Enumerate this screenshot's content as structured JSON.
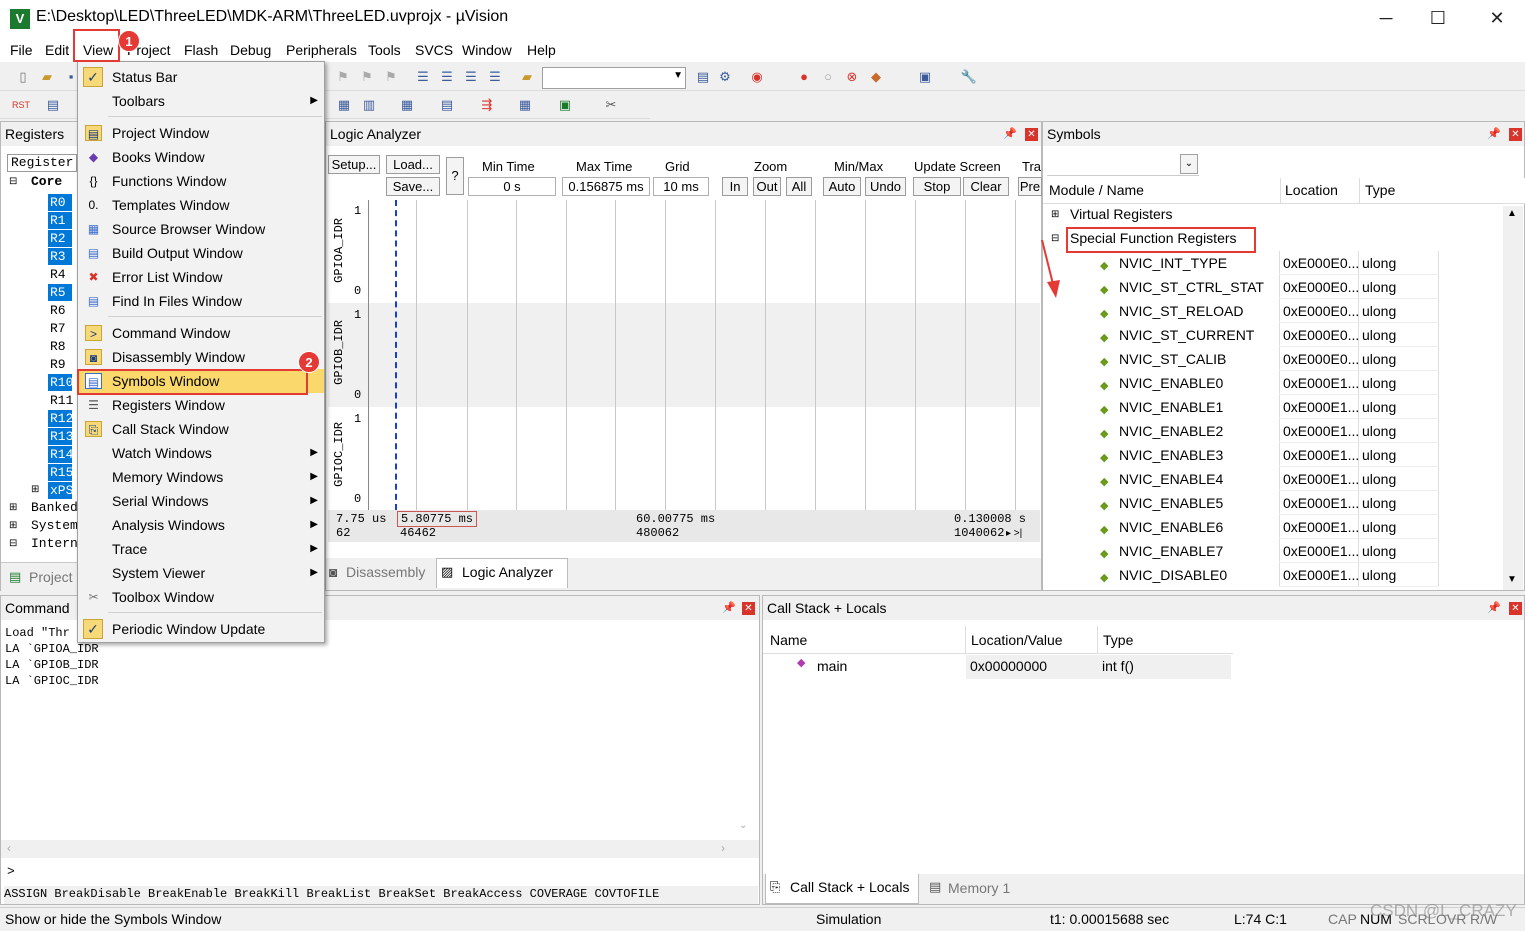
{
  "window": {
    "title": "E:\\Desktop\\LED\\ThreeLED\\MDK-ARM\\ThreeLED.uvprojx - µVision",
    "minimize": "─",
    "maximize": "☐",
    "close": "✕"
  },
  "menubar": [
    "File",
    "Edit",
    "View",
    "Project",
    "Flash",
    "Debug",
    "Peripherals",
    "Tools",
    "SVCS",
    "Window",
    "Help"
  ],
  "annotations": {
    "badge1": "1",
    "badge2": "2"
  },
  "view_menu": {
    "status_bar": "Status Bar",
    "toolbars": "Toolbars",
    "project_window": "Project Window",
    "books_window": "Books Window",
    "functions_window": "Functions Window",
    "templates_window": "Templates Window",
    "source_browser_window": "Source Browser Window",
    "build_output_window": "Build Output Window",
    "error_list_window": "Error List Window",
    "find_in_files_window": "Find In Files Window",
    "command_window": "Command Window",
    "disassembly_window": "Disassembly Window",
    "symbols_window": "Symbols Window",
    "registers_window": "Registers Window",
    "call_stack_window": "Call Stack Window",
    "watch_windows": "Watch Windows",
    "memory_windows": "Memory Windows",
    "serial_windows": "Serial Windows",
    "analysis_windows": "Analysis Windows",
    "trace": "Trace",
    "system_viewer": "System Viewer",
    "toolbox_window": "Toolbox Window",
    "periodic_window_update": "Periodic Window Update"
  },
  "registers_panel": {
    "title": "Registers",
    "header": "Register",
    "core": "Core",
    "regs": [
      "R0",
      "R1",
      "R2",
      "R3",
      "R4",
      "R5",
      "R6",
      "R7",
      "R8",
      "R9",
      "R10",
      "R11",
      "R12",
      "R13",
      "R14",
      "R15",
      "xPS"
    ],
    "groups": [
      "Banked",
      "System",
      "Intern"
    ],
    "tab_project": "Project"
  },
  "logic_analyzer": {
    "title": "Logic Analyzer",
    "setup": "Setup...",
    "load": "Load...",
    "save": "Save...",
    "help": "?",
    "min_time_label": "Min Time",
    "min_time": "0 s",
    "max_time_label": "Max Time",
    "max_time": "0.156875 ms",
    "grid_label": "Grid",
    "grid": "10 ms",
    "zoom_label": "Zoom",
    "zoom_in": "In",
    "zoom_out": "Out",
    "zoom_all": "All",
    "minmax_label": "Min/Max",
    "auto": "Auto",
    "undo": "Undo",
    "update_label": "Update Screen",
    "stop": "Stop",
    "clear": "Clear",
    "trace_label": "Tra",
    "prev": "Pre",
    "signals": [
      "GPIOA_IDR",
      "GPIOB_IDR",
      "GPIOC_IDR"
    ],
    "hi": "1",
    "lo": "0",
    "status_left_time": "7.75 us",
    "status_left_count": "62",
    "status_cursor_time": "5.80775 ms",
    "status_cursor_count": "46462",
    "status_mid_time": "60.00775 ms",
    "status_mid_count": "480062",
    "status_right_time": "0.130008 s",
    "status_right_count": "1040062",
    "tab_disassembly": "Disassembly",
    "tab_logic": "Logic Analyzer"
  },
  "symbols": {
    "title": "Symbols",
    "col_name": "Module / Name",
    "col_location": "Location",
    "col_type": "Type",
    "virtual_registers": "Virtual Registers",
    "special_function_registers": "Special Function Registers",
    "rows": [
      {
        "name": "NVIC_INT_TYPE",
        "loc": "0xE000E0...",
        "type": "ulong"
      },
      {
        "name": "NVIC_ST_CTRL_STAT",
        "loc": "0xE000E0...",
        "type": "ulong"
      },
      {
        "name": "NVIC_ST_RELOAD",
        "loc": "0xE000E0...",
        "type": "ulong"
      },
      {
        "name": "NVIC_ST_CURRENT",
        "loc": "0xE000E0...",
        "type": "ulong"
      },
      {
        "name": "NVIC_ST_CALIB",
        "loc": "0xE000E0...",
        "type": "ulong"
      },
      {
        "name": "NVIC_ENABLE0",
        "loc": "0xE000E1...",
        "type": "ulong"
      },
      {
        "name": "NVIC_ENABLE1",
        "loc": "0xE000E1...",
        "type": "ulong"
      },
      {
        "name": "NVIC_ENABLE2",
        "loc": "0xE000E1...",
        "type": "ulong"
      },
      {
        "name": "NVIC_ENABLE3",
        "loc": "0xE000E1...",
        "type": "ulong"
      },
      {
        "name": "NVIC_ENABLE4",
        "loc": "0xE000E1...",
        "type": "ulong"
      },
      {
        "name": "NVIC_ENABLE5",
        "loc": "0xE000E1...",
        "type": "ulong"
      },
      {
        "name": "NVIC_ENABLE6",
        "loc": "0xE000E1...",
        "type": "ulong"
      },
      {
        "name": "NVIC_ENABLE7",
        "loc": "0xE000E1...",
        "type": "ulong"
      },
      {
        "name": "NVIC_DISABLE0",
        "loc": "0xE000E1...",
        "type": "ulong"
      }
    ]
  },
  "command": {
    "title": "Command",
    "lines": [
      "Load \"Thr",
      "LA `GPIOA_IDR",
      "LA `GPIOB_IDR",
      "LA `GPIOC_IDR"
    ],
    "prompt": ">",
    "autocomplete": "ASSIGN BreakDisable BreakEnable BreakKill BreakList BreakSet BreakAccess COVERAGE COVTOFILE"
  },
  "callstack": {
    "title": "Call Stack + Locals",
    "col_name": "Name",
    "col_loc": "Location/Value",
    "col_type": "Type",
    "row_name": "main",
    "row_loc": "0x00000000",
    "row_type": "int f()",
    "tab_callstack": "Call Stack + Locals",
    "tab_memory": "Memory 1"
  },
  "statusbar": {
    "message": "Show or hide the Symbols Window",
    "mode": "Simulation",
    "time": "t1: 0.00015688 sec",
    "position": "L:74 C:1",
    "cap": "CAP",
    "num": "NUM",
    "scrl": "SCRL",
    "ovr": "OVR",
    "rw": "R/W"
  },
  "watermark": "CSDN @L_CRAZY"
}
